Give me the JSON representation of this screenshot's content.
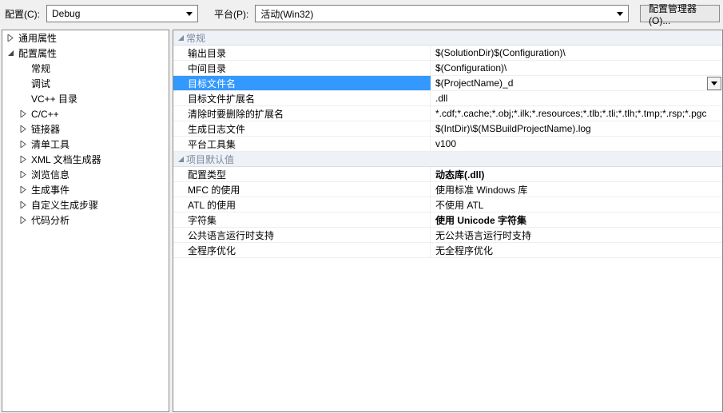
{
  "topbar": {
    "config_label": "配置(C):",
    "config_value": "Debug",
    "platform_label": "平台(P):",
    "platform_value": "活动(Win32)",
    "manager_button": "配置管理器(O)..."
  },
  "tree": {
    "items": [
      {
        "label": "通用属性",
        "depth": 0,
        "expander": "closed"
      },
      {
        "label": "配置属性",
        "depth": 0,
        "expander": "open"
      },
      {
        "label": "常规",
        "depth": 1,
        "expander": "none"
      },
      {
        "label": "调试",
        "depth": 1,
        "expander": "none"
      },
      {
        "label": "VC++ 目录",
        "depth": 1,
        "expander": "none"
      },
      {
        "label": "C/C++",
        "depth": 1,
        "expander": "closed"
      },
      {
        "label": "链接器",
        "depth": 1,
        "expander": "closed"
      },
      {
        "label": "清单工具",
        "depth": 1,
        "expander": "closed"
      },
      {
        "label": "XML 文档生成器",
        "depth": 1,
        "expander": "closed"
      },
      {
        "label": "浏览信息",
        "depth": 1,
        "expander": "closed"
      },
      {
        "label": "生成事件",
        "depth": 1,
        "expander": "closed"
      },
      {
        "label": "自定义生成步骤",
        "depth": 1,
        "expander": "closed"
      },
      {
        "label": "代码分析",
        "depth": 1,
        "expander": "closed"
      }
    ]
  },
  "grid": {
    "sections": [
      {
        "title": "常规",
        "rows": [
          {
            "name": "输出目录",
            "value": "$(SolutionDir)$(Configuration)\\",
            "bold": false
          },
          {
            "name": "中间目录",
            "value": "$(Configuration)\\",
            "bold": false
          },
          {
            "name": "目标文件名",
            "value": "$(ProjectName)_d",
            "bold": false,
            "selected": true
          },
          {
            "name": "目标文件扩展名",
            "value": ".dll",
            "bold": false
          },
          {
            "name": "清除时要删除的扩展名",
            "value": "*.cdf;*.cache;*.obj;*.ilk;*.resources;*.tlb;*.tli;*.tlh;*.tmp;*.rsp;*.pgc",
            "bold": false
          },
          {
            "name": "生成日志文件",
            "value": "$(IntDir)\\$(MSBuildProjectName).log",
            "bold": false
          },
          {
            "name": "平台工具集",
            "value": "v100",
            "bold": false
          }
        ]
      },
      {
        "title": "项目默认值",
        "rows": [
          {
            "name": "配置类型",
            "value": "动态库(.dll)",
            "bold": true
          },
          {
            "name": "MFC 的使用",
            "value": "使用标准 Windows 库",
            "bold": false
          },
          {
            "name": "ATL 的使用",
            "value": "不使用 ATL",
            "bold": false
          },
          {
            "name": "字符集",
            "value": "使用 Unicode 字符集",
            "bold": true
          },
          {
            "name": "公共语言运行时支持",
            "value": "无公共语言运行时支持",
            "bold": false
          },
          {
            "name": "全程序优化",
            "value": "无全程序优化",
            "bold": false
          }
        ]
      }
    ]
  }
}
